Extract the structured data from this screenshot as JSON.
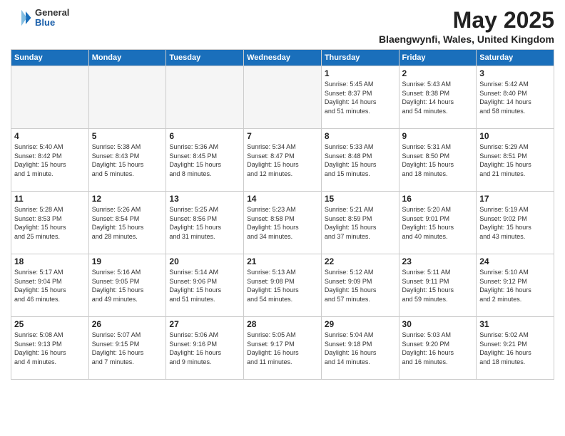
{
  "header": {
    "logo_general": "General",
    "logo_blue": "Blue",
    "month_title": "May 2025",
    "location": "Blaengwynfi, Wales, United Kingdom"
  },
  "days_of_week": [
    "Sunday",
    "Monday",
    "Tuesday",
    "Wednesday",
    "Thursday",
    "Friday",
    "Saturday"
  ],
  "weeks": [
    [
      {
        "day": "",
        "info": ""
      },
      {
        "day": "",
        "info": ""
      },
      {
        "day": "",
        "info": ""
      },
      {
        "day": "",
        "info": ""
      },
      {
        "day": "1",
        "info": "Sunrise: 5:45 AM\nSunset: 8:37 PM\nDaylight: 14 hours\nand 51 minutes."
      },
      {
        "day": "2",
        "info": "Sunrise: 5:43 AM\nSunset: 8:38 PM\nDaylight: 14 hours\nand 54 minutes."
      },
      {
        "day": "3",
        "info": "Sunrise: 5:42 AM\nSunset: 8:40 PM\nDaylight: 14 hours\nand 58 minutes."
      }
    ],
    [
      {
        "day": "4",
        "info": "Sunrise: 5:40 AM\nSunset: 8:42 PM\nDaylight: 15 hours\nand 1 minute."
      },
      {
        "day": "5",
        "info": "Sunrise: 5:38 AM\nSunset: 8:43 PM\nDaylight: 15 hours\nand 5 minutes."
      },
      {
        "day": "6",
        "info": "Sunrise: 5:36 AM\nSunset: 8:45 PM\nDaylight: 15 hours\nand 8 minutes."
      },
      {
        "day": "7",
        "info": "Sunrise: 5:34 AM\nSunset: 8:47 PM\nDaylight: 15 hours\nand 12 minutes."
      },
      {
        "day": "8",
        "info": "Sunrise: 5:33 AM\nSunset: 8:48 PM\nDaylight: 15 hours\nand 15 minutes."
      },
      {
        "day": "9",
        "info": "Sunrise: 5:31 AM\nSunset: 8:50 PM\nDaylight: 15 hours\nand 18 minutes."
      },
      {
        "day": "10",
        "info": "Sunrise: 5:29 AM\nSunset: 8:51 PM\nDaylight: 15 hours\nand 21 minutes."
      }
    ],
    [
      {
        "day": "11",
        "info": "Sunrise: 5:28 AM\nSunset: 8:53 PM\nDaylight: 15 hours\nand 25 minutes."
      },
      {
        "day": "12",
        "info": "Sunrise: 5:26 AM\nSunset: 8:54 PM\nDaylight: 15 hours\nand 28 minutes."
      },
      {
        "day": "13",
        "info": "Sunrise: 5:25 AM\nSunset: 8:56 PM\nDaylight: 15 hours\nand 31 minutes."
      },
      {
        "day": "14",
        "info": "Sunrise: 5:23 AM\nSunset: 8:58 PM\nDaylight: 15 hours\nand 34 minutes."
      },
      {
        "day": "15",
        "info": "Sunrise: 5:21 AM\nSunset: 8:59 PM\nDaylight: 15 hours\nand 37 minutes."
      },
      {
        "day": "16",
        "info": "Sunrise: 5:20 AM\nSunset: 9:01 PM\nDaylight: 15 hours\nand 40 minutes."
      },
      {
        "day": "17",
        "info": "Sunrise: 5:19 AM\nSunset: 9:02 PM\nDaylight: 15 hours\nand 43 minutes."
      }
    ],
    [
      {
        "day": "18",
        "info": "Sunrise: 5:17 AM\nSunset: 9:04 PM\nDaylight: 15 hours\nand 46 minutes."
      },
      {
        "day": "19",
        "info": "Sunrise: 5:16 AM\nSunset: 9:05 PM\nDaylight: 15 hours\nand 49 minutes."
      },
      {
        "day": "20",
        "info": "Sunrise: 5:14 AM\nSunset: 9:06 PM\nDaylight: 15 hours\nand 51 minutes."
      },
      {
        "day": "21",
        "info": "Sunrise: 5:13 AM\nSunset: 9:08 PM\nDaylight: 15 hours\nand 54 minutes."
      },
      {
        "day": "22",
        "info": "Sunrise: 5:12 AM\nSunset: 9:09 PM\nDaylight: 15 hours\nand 57 minutes."
      },
      {
        "day": "23",
        "info": "Sunrise: 5:11 AM\nSunset: 9:11 PM\nDaylight: 15 hours\nand 59 minutes."
      },
      {
        "day": "24",
        "info": "Sunrise: 5:10 AM\nSunset: 9:12 PM\nDaylight: 16 hours\nand 2 minutes."
      }
    ],
    [
      {
        "day": "25",
        "info": "Sunrise: 5:08 AM\nSunset: 9:13 PM\nDaylight: 16 hours\nand 4 minutes."
      },
      {
        "day": "26",
        "info": "Sunrise: 5:07 AM\nSunset: 9:15 PM\nDaylight: 16 hours\nand 7 minutes."
      },
      {
        "day": "27",
        "info": "Sunrise: 5:06 AM\nSunset: 9:16 PM\nDaylight: 16 hours\nand 9 minutes."
      },
      {
        "day": "28",
        "info": "Sunrise: 5:05 AM\nSunset: 9:17 PM\nDaylight: 16 hours\nand 11 minutes."
      },
      {
        "day": "29",
        "info": "Sunrise: 5:04 AM\nSunset: 9:18 PM\nDaylight: 16 hours\nand 14 minutes."
      },
      {
        "day": "30",
        "info": "Sunrise: 5:03 AM\nSunset: 9:20 PM\nDaylight: 16 hours\nand 16 minutes."
      },
      {
        "day": "31",
        "info": "Sunrise: 5:02 AM\nSunset: 9:21 PM\nDaylight: 16 hours\nand 18 minutes."
      }
    ]
  ]
}
